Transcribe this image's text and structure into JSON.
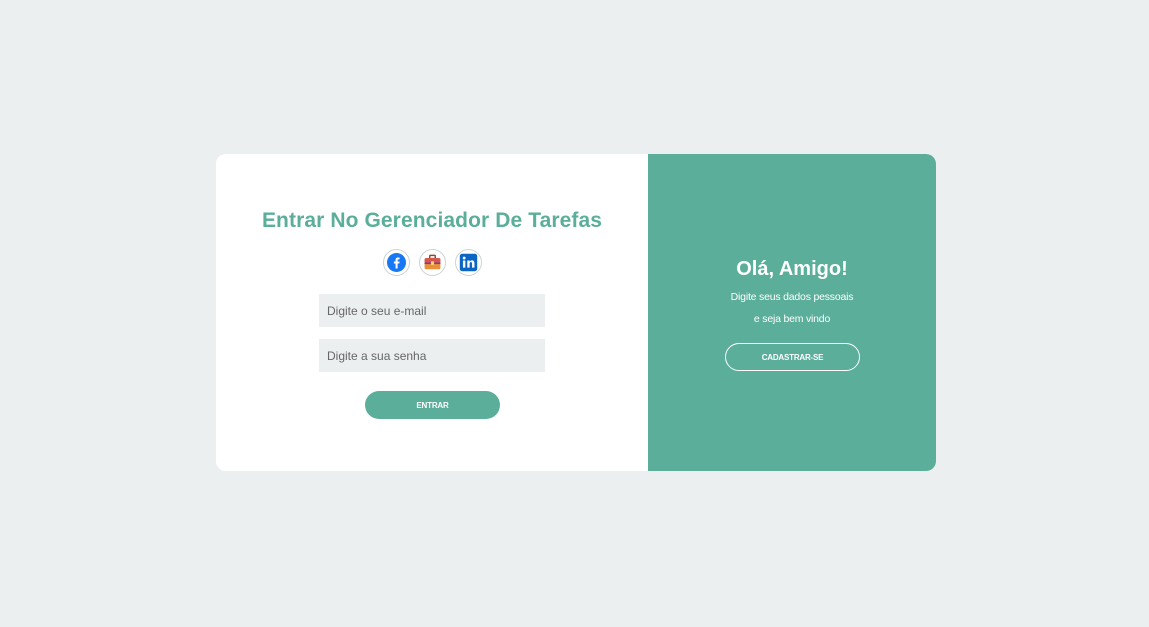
{
  "login": {
    "title": "Entrar No Gerenciador De Tarefas",
    "social": [
      {
        "name": "facebook",
        "icon": "facebook-icon",
        "color": "#1877F2"
      },
      {
        "name": "briefcase",
        "icon": "briefcase-icon",
        "color": "#E8913A"
      },
      {
        "name": "linkedin",
        "icon": "linkedin-icon",
        "color": "#0A66C2"
      }
    ],
    "email_placeholder": "Digite o seu e-mail",
    "password_placeholder": "Digite a sua senha",
    "submit_label": "ENTRAR"
  },
  "welcome": {
    "greeting": "Olá, Amigo!",
    "line1": "Digite seus dados pessoais",
    "line2": "e seja bem vindo",
    "signup_label": "CADASTRAR-SE"
  },
  "colors": {
    "accent": "#5AAE9A",
    "background": "#ECEFF0",
    "card": "#FFFFFF",
    "input_bg": "#ECEFF0"
  }
}
